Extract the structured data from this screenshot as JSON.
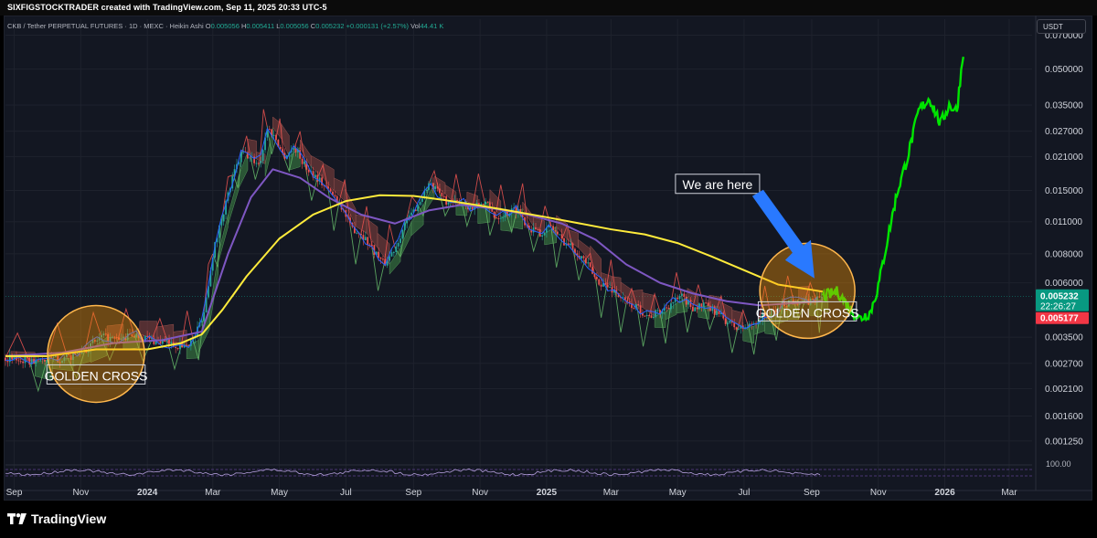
{
  "header": {
    "credit": "SIXFIGSTOCKTRADER created with TradingView.com, Sep 11, 2025 20:33 UTC-5"
  },
  "legend": {
    "symbol": "CKB / Tether PERPETUAL FUTURES · 1D · MEXC · Heikin Ashi",
    "o_label": "O",
    "o_value": "0.005056",
    "h_label": "H",
    "h_value": "0.005411",
    "l_label": "L",
    "l_value": "0.005056",
    "c_label": "C",
    "c_value": "0.005232",
    "change": "+0.000131 (+2.57%)",
    "vol_label": "Vol",
    "vol_value": "44.41 K"
  },
  "price_scale": {
    "unit": "USDT",
    "current_price": "0.005232",
    "countdown": "22:26:27",
    "secondary_price": "0.005177",
    "current_color": "#089981",
    "secondary_color": "#f23645"
  },
  "footer": {
    "brand": "TradingView"
  },
  "colors": {
    "background": "#131722",
    "grid": "#1e222d",
    "ma_long": "#ffeb3b",
    "ma_mid": "#7e57c2",
    "ma_fast": "#2962ff",
    "projection": "#00e600",
    "cloud_bull": "#4caf50",
    "cloud_bear": "#b2524a",
    "circle_fill": "#ff9800",
    "arrow": "#2979ff",
    "osc": "#b39ddb"
  },
  "chart_data": {
    "type": "line",
    "scale": "log",
    "ylim": [
      0.00105,
      0.082
    ],
    "xlim": [
      "2023-08-24",
      "2026-03-22"
    ],
    "yticks": [
      "0.070000",
      "0.050000",
      "0.035000",
      "0.027000",
      "0.021000",
      "0.015000",
      "0.011000",
      "0.008000",
      "0.006000",
      "0.003500",
      "0.002700",
      "0.002100",
      "0.001600",
      "0.001250"
    ],
    "xticks": [
      {
        "label": "Sep",
        "date": "2023-09-01",
        "bold": false
      },
      {
        "label": "Nov",
        "date": "2023-11-01",
        "bold": false
      },
      {
        "label": "2024",
        "date": "2024-01-01",
        "bold": true
      },
      {
        "label": "Mar",
        "date": "2024-03-01",
        "bold": false
      },
      {
        "label": "May",
        "date": "2024-05-01",
        "bold": false
      },
      {
        "label": "Jul",
        "date": "2024-07-01",
        "bold": false
      },
      {
        "label": "Sep",
        "date": "2024-09-01",
        "bold": false
      },
      {
        "label": "Nov",
        "date": "2024-11-01",
        "bold": false
      },
      {
        "label": "2025",
        "date": "2025-01-01",
        "bold": true
      },
      {
        "label": "Mar",
        "date": "2025-03-01",
        "bold": false
      },
      {
        "label": "May",
        "date": "2025-05-01",
        "bold": false
      },
      {
        "label": "Jul",
        "date": "2025-07-01",
        "bold": false
      },
      {
        "label": "Sep",
        "date": "2025-09-01",
        "bold": false
      },
      {
        "label": "Nov",
        "date": "2025-11-01",
        "bold": false
      },
      {
        "label": "2026",
        "date": "2026-01-01",
        "bold": true
      },
      {
        "label": "Mar",
        "date": "2026-03-01",
        "bold": false
      }
    ],
    "series": [
      {
        "key": "price",
        "x": [
          "2023-08-24",
          "2023-09-15",
          "2023-10-01",
          "2023-10-20",
          "2023-11-05",
          "2023-11-20",
          "2023-12-05",
          "2023-12-20",
          "2024-01-05",
          "2024-01-20",
          "2024-02-01",
          "2024-02-12",
          "2024-02-22",
          "2024-03-01",
          "2024-03-10",
          "2024-03-20",
          "2024-03-28",
          "2024-04-05",
          "2024-04-13",
          "2024-04-20",
          "2024-04-28",
          "2024-05-05",
          "2024-05-15",
          "2024-05-25",
          "2024-06-05",
          "2024-06-15",
          "2024-06-25",
          "2024-07-05",
          "2024-07-15",
          "2024-07-25",
          "2024-08-05",
          "2024-08-15",
          "2024-08-25",
          "2024-09-05",
          "2024-09-15",
          "2024-09-25",
          "2024-10-05",
          "2024-10-15",
          "2024-10-25",
          "2024-11-05",
          "2024-11-15",
          "2024-11-25",
          "2024-12-05",
          "2024-12-15",
          "2024-12-25",
          "2025-01-05",
          "2025-01-15",
          "2025-01-25",
          "2025-02-05",
          "2025-02-15",
          "2025-02-25",
          "2025-03-05",
          "2025-03-15",
          "2025-03-25",
          "2025-04-05",
          "2025-04-15",
          "2025-04-25",
          "2025-05-05",
          "2025-05-15",
          "2025-05-25",
          "2025-06-05",
          "2025-06-15",
          "2025-06-25",
          "2025-07-05",
          "2025-07-15",
          "2025-07-25",
          "2025-08-05",
          "2025-08-15",
          "2025-08-25",
          "2025-09-05",
          "2025-09-11"
        ],
        "y": [
          0.00285,
          0.00275,
          0.0028,
          0.00285,
          0.0031,
          0.0035,
          0.0034,
          0.0036,
          0.0034,
          0.0033,
          0.0032,
          0.0034,
          0.0045,
          0.008,
          0.0118,
          0.0175,
          0.022,
          0.0205,
          0.0195,
          0.028,
          0.025,
          0.021,
          0.023,
          0.019,
          0.017,
          0.015,
          0.0135,
          0.0105,
          0.0098,
          0.0085,
          0.0072,
          0.0085,
          0.011,
          0.013,
          0.016,
          0.0145,
          0.013,
          0.0135,
          0.0125,
          0.0135,
          0.0115,
          0.012,
          0.0125,
          0.0105,
          0.0098,
          0.0105,
          0.0092,
          0.0085,
          0.0075,
          0.0062,
          0.0058,
          0.0055,
          0.0049,
          0.0047,
          0.0043,
          0.0045,
          0.0049,
          0.0052,
          0.0047,
          0.0048,
          0.0045,
          0.0041,
          0.0038,
          0.0039,
          0.0042,
          0.0044,
          0.0048,
          0.0051,
          0.0049,
          0.0051,
          0.005232
        ]
      },
      {
        "key": "ma_long",
        "x": [
          "2023-08-24",
          "2023-10-01",
          "2023-11-15",
          "2024-01-01",
          "2024-02-01",
          "2024-02-20",
          "2024-03-10",
          "2024-04-01",
          "2024-05-01",
          "2024-06-01",
          "2024-07-01",
          "2024-08-01",
          "2024-09-01",
          "2024-10-01",
          "2024-11-01",
          "2024-12-01",
          "2025-01-01",
          "2025-02-01",
          "2025-03-01",
          "2025-04-01",
          "2025-05-01",
          "2025-06-01",
          "2025-07-01",
          "2025-08-01",
          "2025-09-11"
        ],
        "y": [
          0.0029,
          0.0029,
          0.0031,
          0.0031,
          0.0033,
          0.0036,
          0.0046,
          0.0064,
          0.0093,
          0.0118,
          0.0135,
          0.0143,
          0.0142,
          0.0136,
          0.0129,
          0.0122,
          0.0115,
          0.0108,
          0.0102,
          0.0097,
          0.0089,
          0.0078,
          0.0068,
          0.0059,
          0.0055
        ]
      },
      {
        "key": "ma_mid",
        "x": [
          "2023-08-24",
          "2023-10-15",
          "2023-12-01",
          "2024-01-15",
          "2024-02-20",
          "2024-03-15",
          "2024-04-05",
          "2024-04-25",
          "2024-05-20",
          "2024-06-15",
          "2024-07-15",
          "2024-08-15",
          "2024-09-15",
          "2024-10-15",
          "2024-11-15",
          "2024-12-15",
          "2025-01-15",
          "2025-02-15",
          "2025-03-15",
          "2025-04-15",
          "2025-05-15",
          "2025-06-15",
          "2025-07-15",
          "2025-08-15",
          "2025-09-11"
        ],
        "y": [
          0.0029,
          0.003,
          0.0033,
          0.0034,
          0.0037,
          0.008,
          0.014,
          0.0185,
          0.017,
          0.014,
          0.0118,
          0.0108,
          0.0123,
          0.013,
          0.0125,
          0.0118,
          0.0108,
          0.0092,
          0.0072,
          0.006,
          0.0054,
          0.005,
          0.0048,
          0.0049,
          0.005
        ]
      },
      {
        "key": "projection",
        "x": [
          "2025-09-11",
          "2025-09-25",
          "2025-10-05",
          "2025-10-15",
          "2025-10-25",
          "2025-11-01",
          "2025-11-10",
          "2025-11-18",
          "2025-11-28",
          "2025-12-08",
          "2025-12-18",
          "2025-12-28",
          "2026-01-05",
          "2026-01-12",
          "2026-01-18"
        ],
        "y": [
          0.005232,
          0.0055,
          0.0047,
          0.0042,
          0.0045,
          0.0058,
          0.0095,
          0.0145,
          0.021,
          0.033,
          0.0375,
          0.029,
          0.035,
          0.033,
          0.06
        ]
      }
    ],
    "annotations": [
      {
        "text": "GOLDEN CROSS",
        "date": "2023-11-15",
        "price": 0.0023
      },
      {
        "text": "GOLDEN CROSS",
        "date": "2025-08-28",
        "price": 0.0043
      },
      {
        "text": "We are here",
        "date": "2025-06-05",
        "price": 0.0158
      }
    ],
    "oscillator": {
      "upper_label": "100.00"
    }
  }
}
